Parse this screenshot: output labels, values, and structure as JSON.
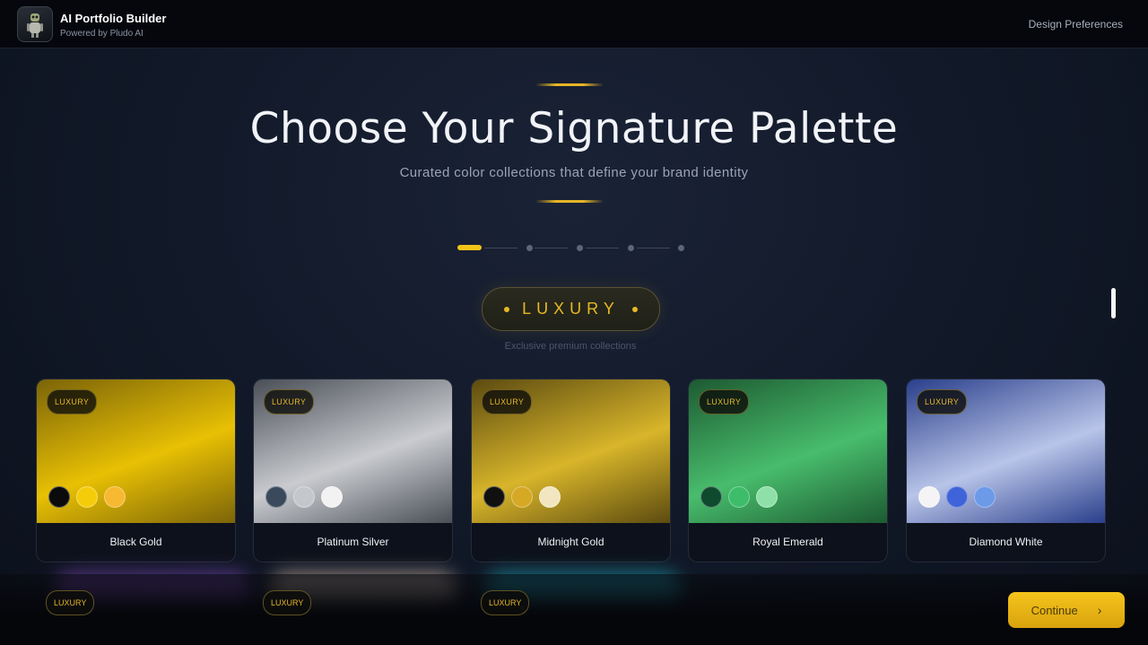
{
  "header": {
    "app_title": "AI Portfolio Builder",
    "app_subtitle": "Powered by Pludo AI",
    "design_preferences": "Design Preferences"
  },
  "hero": {
    "title": "Choose Your Signature Palette",
    "subtitle": "Curated color collections that define your brand identity"
  },
  "stepper": {
    "total_steps": 5,
    "current_step": 1
  },
  "category": {
    "label": "LUXURY",
    "description": "Exclusive premium collections"
  },
  "palettes": [
    {
      "name": "Black Gold",
      "badge": "LUXURY",
      "swatches": [
        "#0b0b0b",
        "#f5cc0a",
        "#f7b832"
      ],
      "gradient": [
        "#7b6408",
        "#e8c004"
      ]
    },
    {
      "name": "Platinum Silver",
      "badge": "LUXURY",
      "swatches": [
        "#3a4a5c",
        "#c4c7cb",
        "#f2f2f2"
      ],
      "gradient": [
        "#4a4f57",
        "#c9cbcf"
      ]
    },
    {
      "name": "Midnight Gold",
      "badge": "LUXURY",
      "swatches": [
        "#101010",
        "#d6a925",
        "#f2e6c0"
      ],
      "gradient": [
        "#5c4b10",
        "#d8b52a"
      ]
    },
    {
      "name": "Royal Emerald",
      "badge": "LUXURY",
      "swatches": [
        "#0f4a2f",
        "#3dbd6a",
        "#8ee0a8"
      ],
      "gradient": [
        "#1d5a32",
        "#48bd6c"
      ]
    },
    {
      "name": "Diamond White",
      "badge": "LUXURY",
      "swatches": [
        "#f4f4f6",
        "#3f63d8",
        "#6c9ae8"
      ],
      "gradient": [
        "#2a3f8c",
        "#b8c4e8"
      ]
    }
  ],
  "next_row_badges": [
    "LUXURY",
    "LUXURY",
    "LUXURY"
  ],
  "page_hint": "5",
  "continue_label": "Continue",
  "colors": {
    "accent_gold": "#f2c418",
    "background": "#121a2a"
  }
}
